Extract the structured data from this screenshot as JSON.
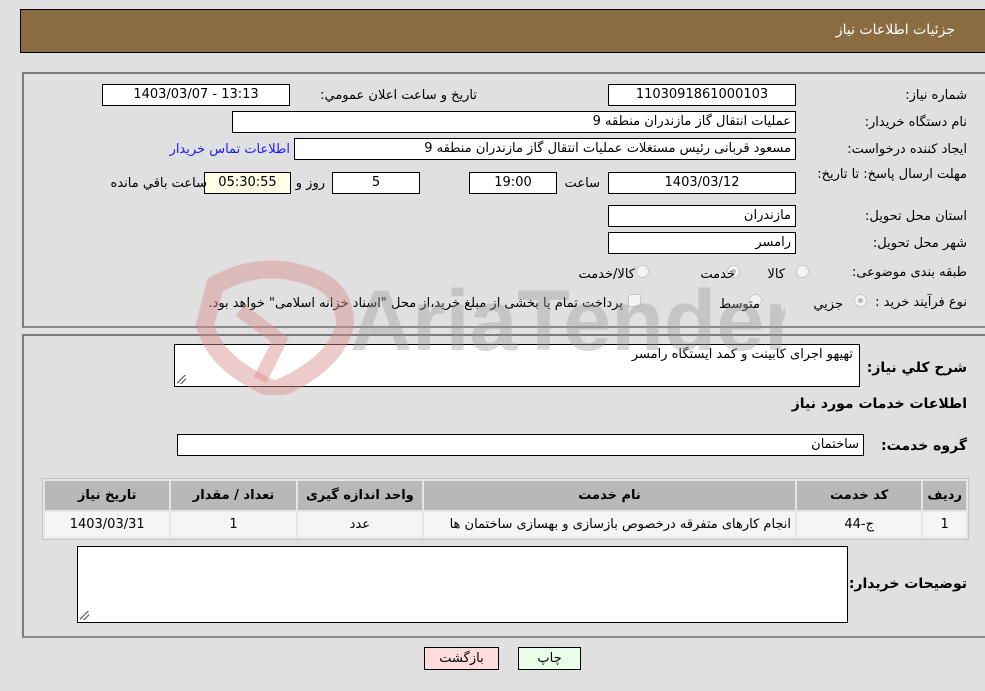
{
  "header": {
    "title": "جزئیات اطلاعات نیاز"
  },
  "details": {
    "need_number_label": "شماره نیاز:",
    "need_number": "1103091861000103",
    "announce_label": "تاریخ و ساعت اعلان عمومي:",
    "announce_value": "1403/03/07 - 13:13",
    "buyer_org_label": "نام دستگاه خریدار:",
    "buyer_org": "عملیات انتقال گاز مازندران منطقه 9",
    "creator_label": "ایجاد کننده درخواست:",
    "creator": "مسعود قربانی رئیس مستغلات عملیات انتقال گاز مازندران منطقه 9",
    "buyer_contact_link": "اطلاعات تماس خریدار",
    "deadline_label": "مهلت ارسال پاسخ: تا تاریخ:",
    "deadline_date": "1403/03/12",
    "time_label": "ساعت",
    "deadline_time": "19:00",
    "days_value": "5",
    "days_label": "روز و",
    "remaining_time": "05:30:55",
    "remaining_label": "ساعت باقي مانده",
    "province_label": "استان محل تحویل:",
    "province": "مازندران",
    "city_label": "شهر محل تحویل:",
    "city": "رامسر",
    "category_label": "طبقه بندی موضوعی:",
    "category_options": [
      {
        "label": "کالا",
        "checked": false
      },
      {
        "label": "خدمت",
        "checked": true
      },
      {
        "label": "کالا/خدمت",
        "checked": false
      }
    ],
    "purchase_type_label": "نوع فرآیند خرید :",
    "purchase_type_options": [
      {
        "label": "جزيي",
        "checked": true
      },
      {
        "label": "متوسط",
        "checked": false
      }
    ],
    "treasury_checkbox_label": "پرداخت تمام یا بخشی از مبلغ خرید،از محل \"اسناد خزانه اسلامی\" خواهد بود.",
    "treasury_checked": false
  },
  "description": {
    "label": "شرح کلي نیاز:",
    "value": "تهیهو اجرای کابینت و کمد ایستگاه رامسر"
  },
  "services": {
    "section_title": "اطلاعات خدمات مورد نیاز",
    "group_label": "گروه خدمت:",
    "group_value": "ساختمان",
    "columns": [
      "ردیف",
      "کد خدمت",
      "نام خدمت",
      "واحد اندازه گیری",
      "تعداد / مقدار",
      "تاریخ نیاز"
    ],
    "rows": [
      [
        "1",
        "ج-44",
        "انجام کارهای متفرقه درخصوص بازسازی و بهسازی ساختمان ها",
        "عدد",
        "1",
        "1403/03/31"
      ]
    ]
  },
  "buyer_notes": {
    "label": "توضیحات خریدار:",
    "value": ""
  },
  "buttons": {
    "print": "چاپ",
    "back": "بازگشت"
  },
  "watermark": {
    "text": "AriaTender.neT"
  }
}
